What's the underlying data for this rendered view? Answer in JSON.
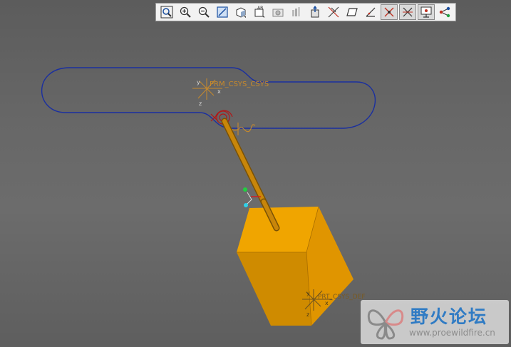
{
  "toolbar": {
    "buttons": [
      {
        "icon": "zoom-fit-icon"
      },
      {
        "icon": "zoom-in-icon"
      },
      {
        "icon": "zoom-out-icon"
      },
      {
        "icon": "repaint-icon"
      },
      {
        "icon": "display-style-icon"
      },
      {
        "icon": "saved-views-icon"
      },
      {
        "icon": "appearance-icon"
      },
      {
        "icon": "layers-icon"
      },
      {
        "icon": "spin-center-icon"
      },
      {
        "icon": "datum-axes-icon"
      },
      {
        "icon": "datum-planes-icon"
      },
      {
        "icon": "datum-points-icon"
      },
      {
        "icon": "csys-display-icon"
      },
      {
        "icon": "annotations-icon"
      },
      {
        "icon": "point-tags-icon"
      },
      {
        "icon": "model-tree-icon"
      }
    ],
    "active_buttons": [
      12,
      13,
      14
    ]
  },
  "model": {
    "csys_upper_label": "PRM_CSYS_CSYS",
    "csys_lower_label": "PRT_CSYS_DEF",
    "axis_y": "y",
    "axis_x": "x",
    "axis_z": "z",
    "colors": {
      "block": "#f0a500",
      "rod": "#c8860a",
      "path": "#1a2fa0",
      "csys": "#c98a2b",
      "joint": "#b01818"
    }
  },
  "watermark": {
    "title": "野火论坛",
    "url": "www.proewildfire.cn"
  }
}
